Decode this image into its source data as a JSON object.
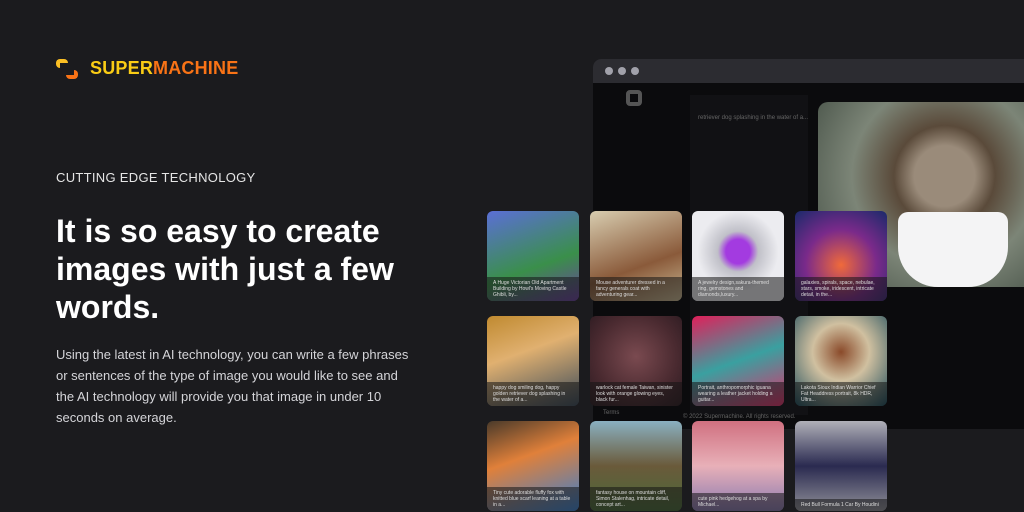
{
  "brand": {
    "part1": "SUPER",
    "part2": "MACHINE"
  },
  "eyebrow": "CUTTING EDGE TECHNOLOGY",
  "headline": "It is so easy to create images with just a few words.",
  "description": "Using the latest in AI technology, you can write a few phrases or sentences of the type of image you would like to see and the AI technology will provide you that image in under 10 seconds on average.",
  "mockup": {
    "caption": "retriever dog splashing in the water of a...",
    "terms": "Terms",
    "copyright": "© 2022 Supermachine. All rights reserved."
  },
  "tiles": [
    {
      "caption": "A Huge Victorian Old Apartment Building by Howl's Moving Castle Ghibli, by...",
      "bg": "linear-gradient(160deg,#5b6fd6,#3a8f4a 60%,#6b3fa0)"
    },
    {
      "caption": "Mouse adventurer dressed in a fancy generals coat with adventuring gear...",
      "bg": "linear-gradient(160deg,#d8cdb0,#8a5a3a 60%,#c9b994)"
    },
    {
      "caption": "A jewelry design,sakura-themed ring, gemstones and diamonds,luxury...",
      "bg": "radial-gradient(circle at 50% 45%,#a33be0 0 18%,#c0c0c8 30%,#ececf0 60%)"
    },
    {
      "caption": "galaxies, spirals, space, nebulae, stars, smoke, iridescent, intricate detail, in the...",
      "bg": "radial-gradient(circle at 50% 60%,#f06a3a,#7a2a8a 50%,#1a2a6a)"
    },
    {
      "caption": "happy dog smiling dog, happy golden retriever dog splashing in the water of a...",
      "bg": "linear-gradient(160deg,#c08a30,#e0b070 40%,#3a4a5a)"
    },
    {
      "caption": "warlock cat female Taiwan, sinister look with orange glowing eyes, black fur...",
      "bg": "radial-gradient(circle at 50% 45%,#7a4a50,#4a2a30 60%,#2a1a20)"
    },
    {
      "caption": "Portrait, anthropomorphic iguana wearing a leather jacket holding a guitar...",
      "bg": "linear-gradient(160deg,#e0205a,#3aa0a0 50%,#e0306a)"
    },
    {
      "caption": "Lakota Sioux Indian Warrior Chief Fat Headdress portrait, 8k HDR, Ultra...",
      "bg": "radial-gradient(circle at 50% 40%,#8a4a2a,#d0c0a0 40%,#1a4a5a)"
    },
    {
      "caption": "Tiny cute adorable fluffy fox with knitted blue scarf leaning at a table in a...",
      "bg": "linear-gradient(160deg,#4a3a2a,#e0803a 40%,#3a80d0)"
    },
    {
      "caption": "fantasy house on mountain cliff, Simon Stalenhag, intricate detail, concept art...",
      "bg": "linear-gradient(180deg,#8ab0c0,#6a5a3a 50%,#4a6a3a)"
    },
    {
      "caption": "cute pink hedgehog at a spa by Michael...",
      "bg": "linear-gradient(180deg,#d07080,#e8b0b8 50%,#8a7ab0)"
    },
    {
      "caption": "Red Bull Formula 1 Car By Houdini",
      "bg": "linear-gradient(180deg,#b0b0b8,#2a2a50 50%,#909098)"
    }
  ]
}
